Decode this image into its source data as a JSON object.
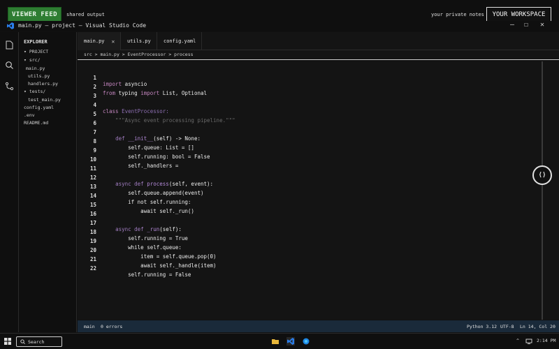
{
  "overlay": {
    "viewer_feed": "VIEWER FEED",
    "shared_output": "shared output",
    "private_notes": "your private notes",
    "your_workspace": "YOUR WORKSPACE"
  },
  "window": {
    "title": "main.py — project — Visual Studio Code",
    "minimize": "—",
    "maximize": "☐",
    "close": "✕"
  },
  "explorer": {
    "header": "EXPLORER",
    "items": [
      {
        "label": "▾ PROJECT"
      },
      {
        "label": "▾ src/"
      },
      {
        "label": "main.py"
      },
      {
        "label": "utils.py"
      },
      {
        "label": "handlers.py"
      },
      {
        "label": "▾ tests/"
      },
      {
        "label": "test_main.py"
      },
      {
        "label": "config.yaml"
      },
      {
        "label": ".env"
      },
      {
        "label": "README.md"
      }
    ]
  },
  "tabs": [
    {
      "label": "main.py",
      "close": "✕"
    },
    {
      "label": "utils.py"
    },
    {
      "label": "config.yaml"
    }
  ],
  "breadcrumb": "src > main.py > EventProcessor > process",
  "code_lines": [
    "1",
    "2",
    "3",
    "4",
    "5",
    "6",
    "7",
    "8",
    "9",
    "10",
    "11",
    "12",
    "13",
    "14",
    "15",
    "16",
    "17",
    "18",
    "19",
    "20",
    "21",
    "22"
  ],
  "code": {
    "l1": {
      "kw": "import",
      "rest": " asyncio"
    },
    "l2": {
      "kw": "from",
      "mid": " typing ",
      "kw2": "import",
      "rest": " List, Optional"
    },
    "l4": {
      "kw": "class",
      "name": " EventProcessor:"
    },
    "l5": {
      "str": "    \"\"\"Async event processing pipeline.\"\"\""
    },
    "l7": {
      "pre": "    ",
      "kw": "def",
      "fn": " __init__",
      "rest": "(self) -> None:"
    },
    "l8": "        self.queue: List = []",
    "l9": "        self.running: bool = False",
    "l10": "        self._handlers =",
    "l12": {
      "pre": "    ",
      "kw": "async def",
      "fn": " process",
      "rest": "(self, event):"
    },
    "l13": "        self.queue.append(event)",
    "l14": "        if not self.running:",
    "l15": "            await self._run()",
    "l17": {
      "pre": "    ",
      "kw": "async def",
      "fn": " _run",
      "rest": "(self):"
    },
    "l18": "        self.running = True",
    "l19": "        while self.queue:",
    "l20": "            item = self.queue.pop(0)",
    "l21": "            await self._handle(item)",
    "l22": "        self.running = False"
  },
  "fab_label": "⟨⟩",
  "status": {
    "branch": "main",
    "errors": "0 errors",
    "python": "Python 3.12",
    "encoding": "UTF-8",
    "position": "Ln 14, Col 20"
  },
  "taskbar": {
    "search": "Search",
    "chevron": "^",
    "time": "2:14 PM"
  },
  "colors": {
    "accent_green": "#2e7d32",
    "status_bar": "#1a2a3a",
    "keyword": "#c586c0",
    "vscode_blue": "#2b7de9"
  }
}
